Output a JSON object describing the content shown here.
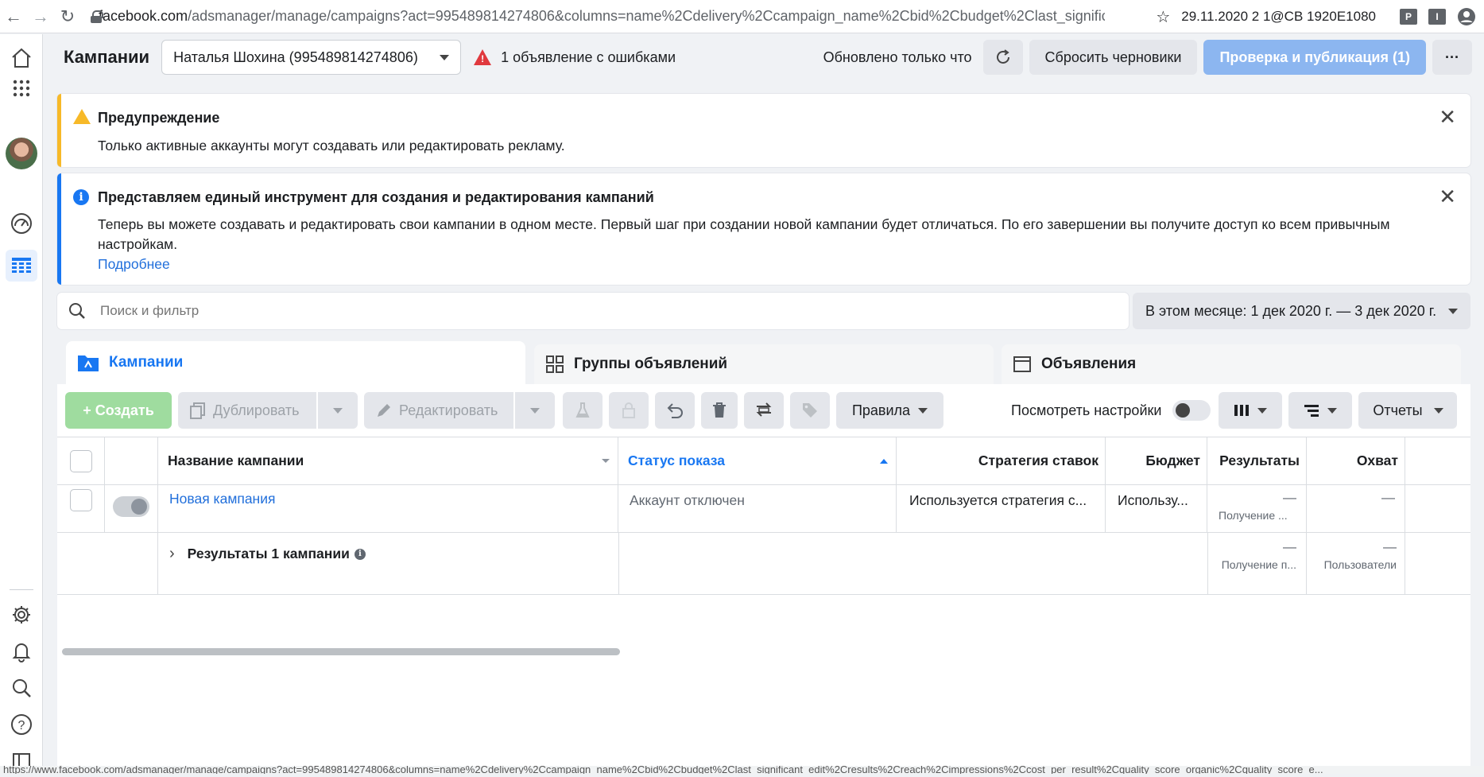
{
  "browser": {
    "url_host": "facebook.com",
    "url_rest": "/adsmanager/manage/campaigns?act=995489814274806&columns=name%2Cdelivery%2Ccampaign_name%2Cbid%2Cbudget%2Clast_significant...",
    "stamp": "29.11.2020 2 1@CB 1920E1080",
    "ext1": "P",
    "ext2": "I"
  },
  "header": {
    "title": "Кампании",
    "account": "Наталья Шохина (995489814274806)",
    "error_text": "1 объявление с ошибками",
    "updated": "Обновлено только что",
    "reset_drafts": "Сбросить черновики",
    "publish": "Проверка и публикация (1)",
    "more": "···"
  },
  "warning": {
    "title": "Предупреждение",
    "text": "Только активные аккаунты могут создавать или редактировать рекламу."
  },
  "info": {
    "title": "Представляем единый инструмент для создания и редактирования кампаний",
    "text": "Теперь вы можете создавать и редактировать свои кампании в одном месте. Первый шаг при создании новой кампании будет отличаться. По его завершении вы получите доступ ко всем привычным настройкам.",
    "link": "Подробнее"
  },
  "search": {
    "placeholder": "Поиск и фильтр"
  },
  "date_range": "В этом месяце: 1 дек 2020 г. — 3 дек 2020 г.",
  "tabs": {
    "campaigns": "Кампании",
    "adsets": "Группы объявлений",
    "ads": "Объявления"
  },
  "toolbar": {
    "create": "+ Создать",
    "duplicate": "Дублировать",
    "edit": "Редактировать",
    "rules": "Правила",
    "view_settings": "Посмотреть настройки",
    "reports": "Отчеты"
  },
  "table": {
    "columns": {
      "name": "Название кампании",
      "delivery": "Статус показа",
      "bid": "Стратегия ставок",
      "budget": "Бюджет",
      "results": "Результаты",
      "reach": "Охват"
    },
    "row": {
      "name": "Новая кампания",
      "delivery": "Аккаунт отключен",
      "bid": "Используется стратегия с...",
      "budget": "Использу...",
      "results": "—",
      "results_sub": "Получение ...",
      "reach": "—"
    },
    "summary": {
      "label": "Результаты 1 кампании",
      "results": "—",
      "results_sub": "Получение п...",
      "reach": "—",
      "reach_sub": "Пользователи"
    }
  },
  "statusbar": "https://www.facebook.com/adsmanager/manage/campaigns?act=995489814274806&columns=name%2Cdelivery%2Ccampaign_name%2Cbid%2Cbudget%2Clast_significant_edit%2Cresults%2Creach%2Cimpressions%2Ccost_per_result%2Cquality_score_organic%2Cquality_score_e..."
}
